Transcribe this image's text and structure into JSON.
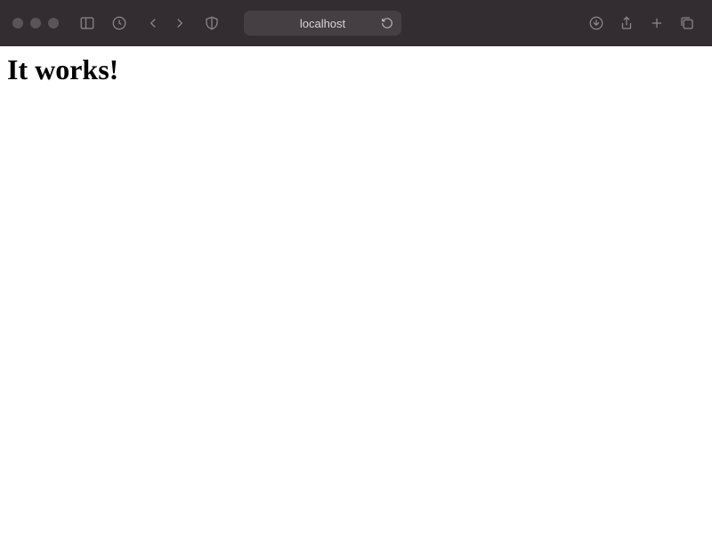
{
  "address_bar": {
    "text": "localhost"
  },
  "page": {
    "heading": "It works!"
  }
}
